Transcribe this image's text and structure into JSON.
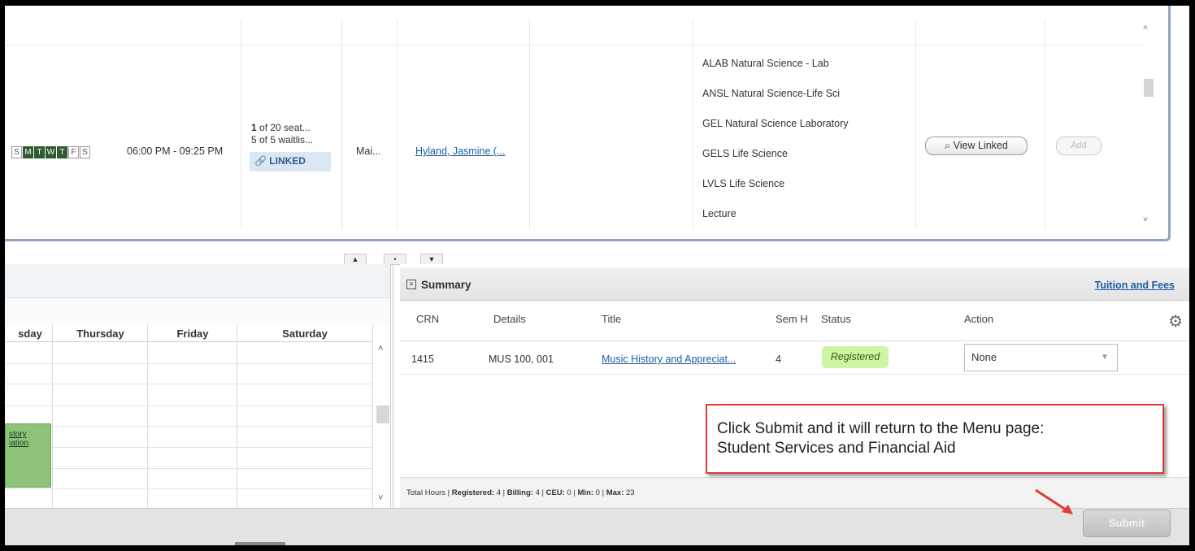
{
  "results": {
    "days": [
      {
        "label": "S",
        "active": false
      },
      {
        "label": "M",
        "active": true
      },
      {
        "label": "T",
        "active": true
      },
      {
        "label": "W",
        "active": true
      },
      {
        "label": "T",
        "active": true
      },
      {
        "label": "F",
        "active": false
      },
      {
        "label": "S",
        "active": false
      }
    ],
    "time": "06:00 PM - 09:25 PM",
    "seats_number": "1",
    "seats_text": " of 20 seat...",
    "waitlist": "5 of 5 waitlis...",
    "linked_label": "LINKED",
    "campus": "Mai...",
    "instructor": "Hyland, Jasmine (...",
    "attributes": [
      "ALAB Natural Science - Lab",
      "ANSL Natural Science-Life Sci",
      "GEL Natural Science Laboratory",
      "GELS Life Science",
      "LVLS Life Science",
      "Lecture"
    ],
    "view_linked_label": "View Linked",
    "add_label": "Add"
  },
  "calendar": {
    "day_headers": [
      "sday",
      "Thursday",
      "Friday",
      "Saturday"
    ],
    "event_line1": "story",
    "event_line2": "iation"
  },
  "summary": {
    "title": "Summary",
    "tuition_link": "Tuition and Fees",
    "columns": [
      "CRN",
      "Details",
      "Title",
      "Sem H",
      "Status",
      "Action"
    ],
    "row": {
      "crn": "1415",
      "details": "MUS 100, 001",
      "title": "Music History and Appreciat...",
      "hours": "4",
      "status": "Registered",
      "action": "None"
    },
    "footer": {
      "prefix": "Total Hours | ",
      "registered_label": "Registered:",
      "registered": " 4 | ",
      "billing_label": "Billing:",
      "billing": " 4 | ",
      "ceu_label": "CEU:",
      "ceu": " 0 | ",
      "min_label": "Min:",
      "min": " 0 | ",
      "max_label": "Max:",
      "max": " 23"
    }
  },
  "callout": {
    "line1": "Click Submit and it will return to the Menu page:",
    "line2": "Student Services and Financial Aid"
  },
  "submit_label": "Submit",
  "colors": {
    "day_active": "#2f5b30",
    "status_badge": "#ccf5a4",
    "event_block": "#8ec47a",
    "callout_border": "#e03a3a",
    "link": "#1b5fa0"
  }
}
